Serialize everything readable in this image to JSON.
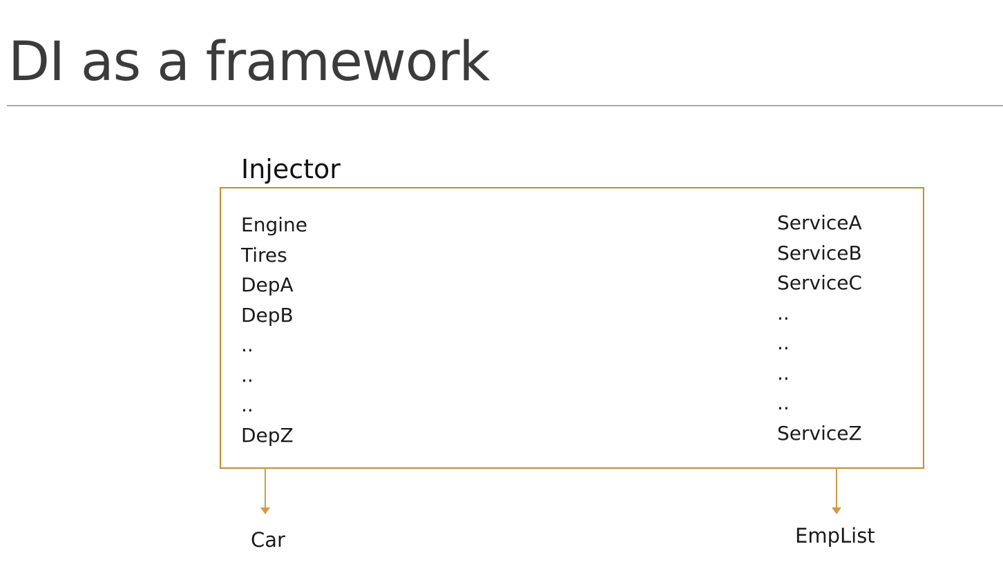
{
  "slide": {
    "title": "DI as a framework"
  },
  "injector": {
    "label": "Injector",
    "dependencies": [
      "Engine",
      "Tires",
      "DepA",
      "DepB",
      "..",
      "..",
      "..",
      "DepZ"
    ],
    "services": [
      "ServiceA",
      "ServiceB",
      "ServiceC",
      "..",
      "..",
      "..",
      "..",
      "ServiceZ"
    ]
  },
  "consumers": {
    "left": "Car",
    "right": "EmpList"
  },
  "colors": {
    "box_border": "#c98a2b",
    "arrow": "#d39b45",
    "title": "#3b3b3b",
    "rule": "#a9a9a9"
  }
}
